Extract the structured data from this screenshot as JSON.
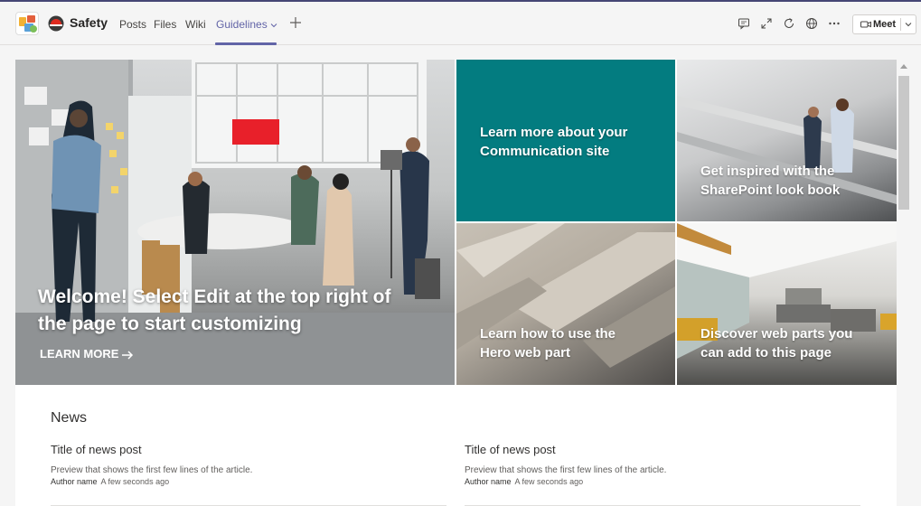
{
  "header": {
    "team_name": "Safety",
    "tabs": [
      {
        "label": "Posts"
      },
      {
        "label": "Files"
      },
      {
        "label": "Wiki"
      },
      {
        "label": "Guidelines"
      }
    ],
    "meet_label": "Meet",
    "icons": [
      "team-logo-icon",
      "safety-helmet-icon",
      "chevron-down-icon",
      "add-tab-icon",
      "conversation-icon",
      "expand-icon",
      "refresh-icon",
      "globe-icon",
      "more-options-icon",
      "video-camera-icon"
    ]
  },
  "hero": {
    "main": {
      "title_line1": "Welcome! Select Edit at the top right of",
      "title_line2": "the page to start customizing",
      "cta": "LEARN MORE"
    },
    "tiles": [
      {
        "line1": "Learn more about your",
        "line2": "Communication site"
      },
      {
        "line1": "Get inspired with the",
        "line2": "SharePoint look book"
      },
      {
        "line1": "Learn how to use the",
        "line2": "Hero web part"
      },
      {
        "line1": "Discover web parts you",
        "line2": "can add to this page"
      }
    ]
  },
  "news": {
    "heading": "News",
    "posts": [
      {
        "title": "Title of news post",
        "preview": "Preview that shows the first few lines of the article.",
        "author": "Author name",
        "time": "A few seconds ago"
      },
      {
        "title": "Title of news post",
        "preview": "Preview that shows the first few lines of the article.",
        "author": "Author name",
        "time": "A few seconds ago"
      }
    ]
  },
  "colors": {
    "accent": "#6264a7",
    "teal_tile": "#037c80",
    "top_bar": "#464775"
  }
}
